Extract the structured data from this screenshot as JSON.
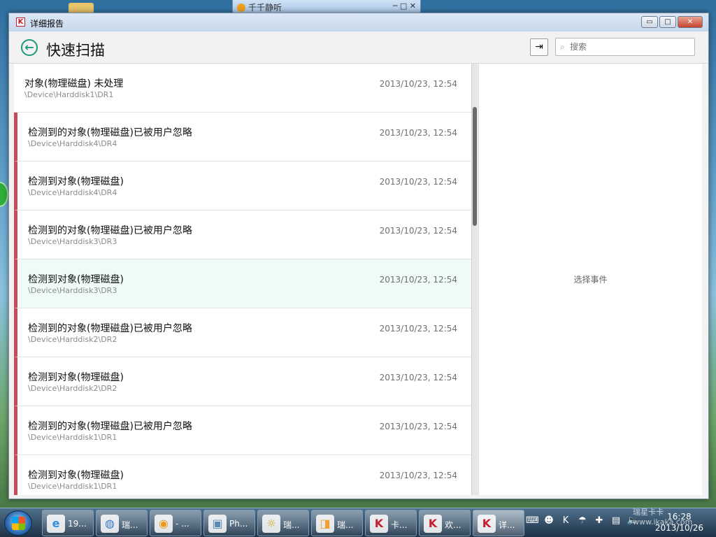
{
  "window": {
    "title": "详细报告",
    "controls": {
      "minimize": "▭",
      "maximize": "□",
      "close": "✕"
    }
  },
  "background": {
    "window_title": "千千静听",
    "window_controls": "─  □  ✕"
  },
  "header": {
    "title": "快速扫描",
    "search_placeholder": "搜索"
  },
  "events": [
    {
      "title": "对象(物理磁盘) 未处理",
      "path": "\\Device\\Harddisk1\\DR1",
      "time": "2013/10/23, 12:54",
      "flag": false,
      "selected": false
    },
    {
      "title": "检测到的对象(物理磁盘)已被用户忽略",
      "path": "\\Device\\Harddisk4\\DR4",
      "time": "2013/10/23, 12:54",
      "flag": true,
      "selected": false
    },
    {
      "title": "检测到对象(物理磁盘)",
      "path": "\\Device\\Harddisk4\\DR4",
      "time": "2013/10/23, 12:54",
      "flag": true,
      "selected": false
    },
    {
      "title": "检测到的对象(物理磁盘)已被用户忽略",
      "path": "\\Device\\Harddisk3\\DR3",
      "time": "2013/10/23, 12:54",
      "flag": true,
      "selected": false
    },
    {
      "title": "检测到对象(物理磁盘)",
      "path": "\\Device\\Harddisk3\\DR3",
      "time": "2013/10/23, 12:54",
      "flag": true,
      "selected": true
    },
    {
      "title": "检测到的对象(物理磁盘)已被用户忽略",
      "path": "\\Device\\Harddisk2\\DR2",
      "time": "2013/10/23, 12:54",
      "flag": true,
      "selected": false
    },
    {
      "title": "检测到对象(物理磁盘)",
      "path": "\\Device\\Harddisk2\\DR2",
      "time": "2013/10/23, 12:54",
      "flag": true,
      "selected": false
    },
    {
      "title": "检测到的对象(物理磁盘)已被用户忽略",
      "path": "\\Device\\Harddisk1\\DR1",
      "time": "2013/10/23, 12:54",
      "flag": true,
      "selected": false
    },
    {
      "title": "检测到对象(物理磁盘)",
      "path": "\\Device\\Harddisk1\\DR1",
      "time": "2013/10/23, 12:54",
      "flag": true,
      "selected": false
    }
  ],
  "detail": {
    "empty_text": "选择事件"
  },
  "taskbar": {
    "tasks": [
      {
        "label": "19...",
        "icon": "e",
        "color": "#2f8ee0",
        "active": false
      },
      {
        "label": "瑞...",
        "icon": "◍",
        "color": "#3a78c8",
        "active": false
      },
      {
        "label": "- ...",
        "icon": "◉",
        "color": "#e89a1c",
        "active": false
      },
      {
        "label": "Ph...",
        "icon": "▣",
        "color": "#5a8bb5",
        "active": false
      },
      {
        "label": "瑞...",
        "icon": "☼",
        "color": "#d9a21a",
        "active": false
      },
      {
        "label": "瑞...",
        "icon": "◨",
        "color": "#f0a030",
        "active": false
      },
      {
        "label": "卡...",
        "icon": "K",
        "color": "#c2202f",
        "active": false
      },
      {
        "label": "欢...",
        "icon": "K",
        "color": "#c2202f",
        "active": false
      },
      {
        "label": "详...",
        "icon": "K",
        "color": "#c2202f",
        "active": true
      }
    ],
    "tray_icons": [
      "⌨",
      "☻",
      "K",
      "☂",
      "✚",
      "▤",
      "🔈"
    ],
    "time": "16:28",
    "date": "2013/10/26"
  },
  "watermark": "瑞星卡卡 www.ikaka.com",
  "colors": {
    "accent": "#1a9a7a",
    "flag": "#c54a5a",
    "selected_row": "#eefbf6"
  }
}
